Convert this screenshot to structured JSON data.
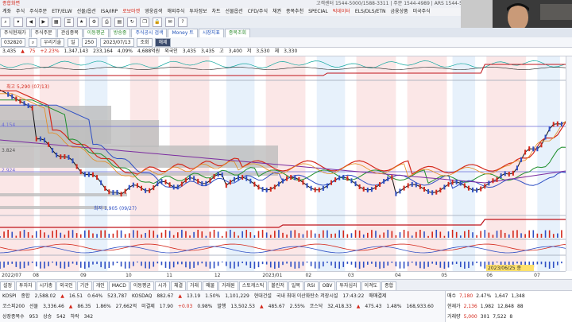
{
  "window": {
    "title": "종합화면",
    "info": "고객센터 1544-5000/1588-3311 | 주문 1544-4989 | ARS 1544-5000"
  },
  "menu": [
    "계좌",
    "주식",
    "주식주문",
    "ETF/ELW",
    "선물/옵션",
    "ISA/IRP",
    "로보마켓",
    "영웅검색",
    "해외주식",
    "투자정보",
    "차트",
    "선물옵션",
    "CFD/주식",
    "채권",
    "종목추천",
    "SPECIAL",
    "빅데이터",
    "ELS/DLS/ETN",
    "금융상품",
    "미국주식"
  ],
  "menu_highlight": [
    "로보마켓",
    "빅데이터"
  ],
  "tabs": [
    {
      "label": "주식현재가",
      "c": ""
    },
    {
      "label": "주식주문",
      "c": ""
    },
    {
      "label": "관심종목",
      "c": ""
    },
    {
      "label": "이동평균",
      "c": "green"
    },
    {
      "label": "방송중",
      "c": "green"
    },
    {
      "label": "주식공시 검색",
      "c": "blue"
    },
    {
      "label": "Money 트",
      "c": "blue"
    },
    {
      "label": "시장지표",
      "c": "blue"
    },
    {
      "label": "종목조회",
      "c": "green"
    }
  ],
  "subtool": {
    "code": "032820",
    "name": "우리기술",
    "period": "일",
    "count": "250",
    "date": "2023/07/13",
    "btn1": "조회",
    "btn2": "해제"
  },
  "inforow": {
    "values": [
      "3,435",
      "▲",
      "75",
      "+2.23%",
      "1,347,143",
      "233,164",
      "4,09%",
      "4,688억원",
      "외국인",
      "3,435",
      "3,435",
      "고",
      "3,400",
      "저",
      "3,530",
      "체",
      "3,330"
    ]
  },
  "chart_labels": {
    "high_marker": "최고 5,290 (07/13)",
    "low_marker": "최저 1,905 (09/27)",
    "level_left1": "4.154",
    "level_left2": "3.824",
    "level_left3": "2.924"
  },
  "xaxis": [
    {
      "label": "2022/07",
      "pct": 0.3
    },
    {
      "label": "08",
      "pct": 5.8
    },
    {
      "label": "09",
      "pct": 14.2
    },
    {
      "label": "10",
      "pct": 22.2
    },
    {
      "label": "11",
      "pct": 29.4
    },
    {
      "label": "12",
      "pct": 37.9
    },
    {
      "label": "2023/01",
      "pct": 46.4
    },
    {
      "label": "02",
      "pct": 54.0
    },
    {
      "label": "03",
      "pct": 61.5
    },
    {
      "label": "04",
      "pct": 69.8
    },
    {
      "label": "05",
      "pct": 78.0
    },
    {
      "label": "06",
      "pct": 86.0
    },
    {
      "label": "07",
      "pct": 94.4
    }
  ],
  "date_marker": "2023/06/25 종",
  "indicator_tabs": [
    "설정",
    "투자자",
    "시가총",
    "외국인",
    "기관",
    "개인",
    "MACD",
    "이동평균",
    "시가",
    "체결",
    "거래",
    "매물",
    "거래원",
    "스토캐스틱",
    "볼린저",
    "일목",
    "RSI",
    "OBV",
    "투자심리",
    "이격도",
    "종합"
  ],
  "ticker": {
    "row1": [
      "KOSPI",
      "종합",
      "2,588.02",
      "▲",
      "16.51",
      "0.64%",
      "523,787",
      "KOSDAQ",
      "882.67",
      "▲",
      "13.19",
      "1.50%",
      "1,101,229",
      "현대건설",
      "국내 최대 이산화탄소 저장시설",
      "17:43:22",
      "매매결제"
    ],
    "row2": [
      "코스피200",
      "선물",
      "3,336.46",
      "▲",
      "86.35",
      "1.86%",
      "27,662억",
      "미결제",
      "17.90",
      "+0.03",
      "0.98%",
      "발행",
      "13,502.53",
      "▲",
      "485.67",
      "2.55%",
      "코스닥",
      "32,418.33",
      "▲",
      "475.43",
      "1.48%",
      "168,933.60"
    ],
    "row3": [
      "상장종목수",
      "953",
      "상승",
      "542",
      "하락",
      "342"
    ]
  },
  "quote": {
    "row1": [
      "매수",
      "7,180",
      "2.47%",
      "1,647",
      "1,348"
    ],
    "row2": [
      "현재가",
      "2,136",
      "1,982",
      "12,848",
      "88"
    ],
    "row3": [
      "거래량",
      "5,000",
      "301",
      "7,522",
      "8"
    ]
  },
  "colors": {
    "bg_red_band": "#f8d7d7",
    "bg_blue_band": "#d7e7f8",
    "ma_green": "#1e8f2b",
    "ma_blue": "#2e4fc4",
    "ma_purple": "#7b2ca0",
    "ma_red": "#d4281b",
    "ma_orange": "#e58b1d",
    "candle_up": "#d4281b",
    "candle_down": "#2e4fc4"
  }
}
